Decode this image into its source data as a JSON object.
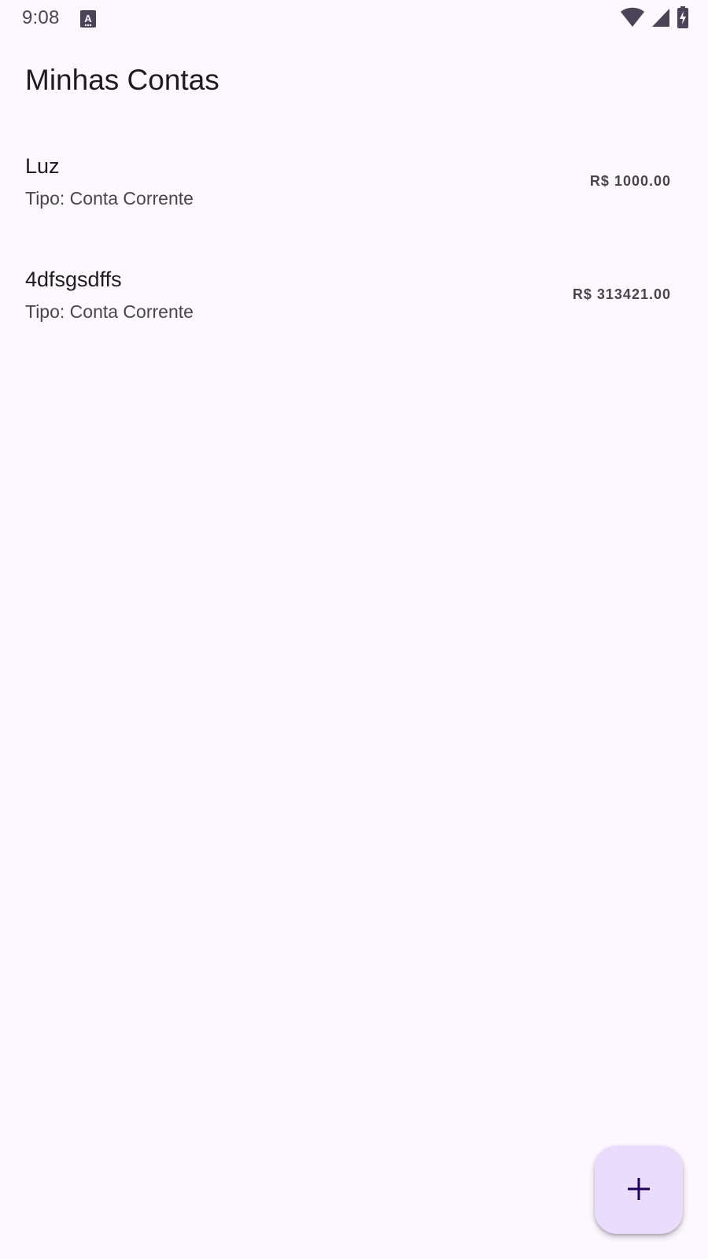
{
  "status_bar": {
    "time": "9:08",
    "icons": [
      "text-accessibility-icon",
      "wifi-icon",
      "cell-signal-icon",
      "battery-charging-icon"
    ]
  },
  "header": {
    "title": "Minhas Contas"
  },
  "accounts": [
    {
      "name": "Luz",
      "type": "Tipo: Conta Corrente",
      "amount": "R$ 1000.00"
    },
    {
      "name": "4dfsgsdffs",
      "type": "Tipo: Conta Corrente",
      "amount": "R$ 313421.00"
    }
  ],
  "fab": {
    "icon": "add-icon"
  },
  "colors": {
    "background": "#fdf7ff",
    "fab_background": "#eadcfd",
    "fab_icon": "#21005d",
    "primary_text": "#1d1b20",
    "secondary_text": "#49454f"
  }
}
